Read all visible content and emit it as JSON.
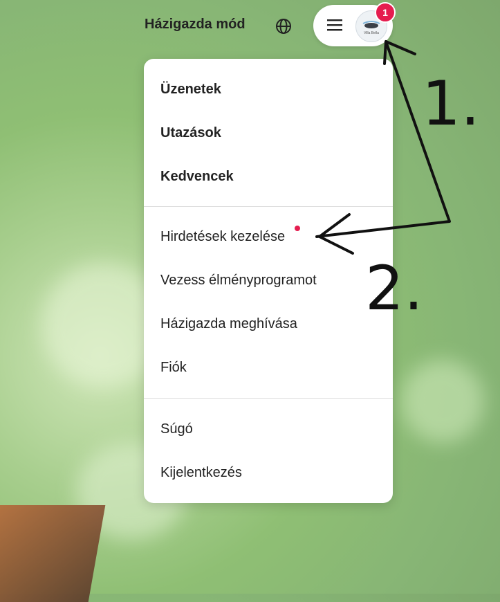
{
  "header": {
    "host_mode_label": "Házigazda mód",
    "globe_icon": "globe-icon",
    "menu_icon": "hamburger-icon",
    "notification_count": "1",
    "avatar_text": "Villa Bella"
  },
  "menu": {
    "group1": [
      "Üzenetek",
      "Utazások",
      "Kedvencek"
    ],
    "group2": [
      "Hirdetések kezelése",
      "Vezess élményprogramot",
      "Házigazda meghívása",
      "Fiók"
    ],
    "group3": [
      "Súgó",
      "Kijelentkezés"
    ]
  },
  "annotations": {
    "step1": "1.",
    "step2": "2."
  },
  "colors": {
    "accent": "#e51d4f",
    "text": "#222222"
  }
}
